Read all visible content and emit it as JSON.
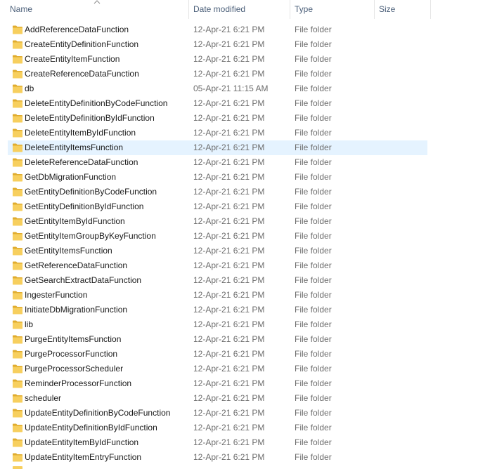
{
  "columns": {
    "name": "Name",
    "date": "Date modified",
    "type": "Type",
    "size": "Size"
  },
  "icons": {
    "sort": "sort-ascending-icon",
    "item": "folder-icon"
  },
  "colors": {
    "folder": "#f7cf5e",
    "folder_dark": "#e0ac2f",
    "selection": "#e5f3ff",
    "header_text": "#4c607a"
  },
  "selected_index": 8,
  "rows": [
    {
      "name": "AddReferenceDataFunction",
      "date": "12-Apr-21 6:21 PM",
      "type": "File folder",
      "size": ""
    },
    {
      "name": "CreateEntityDefinitionFunction",
      "date": "12-Apr-21 6:21 PM",
      "type": "File folder",
      "size": ""
    },
    {
      "name": "CreateEntityItemFunction",
      "date": "12-Apr-21 6:21 PM",
      "type": "File folder",
      "size": ""
    },
    {
      "name": "CreateReferenceDataFunction",
      "date": "12-Apr-21 6:21 PM",
      "type": "File folder",
      "size": ""
    },
    {
      "name": "db",
      "date": "05-Apr-21 11:15 AM",
      "type": "File folder",
      "size": ""
    },
    {
      "name": "DeleteEntityDefinitionByCodeFunction",
      "date": "12-Apr-21 6:21 PM",
      "type": "File folder",
      "size": ""
    },
    {
      "name": "DeleteEntityDefinitionByIdFunction",
      "date": "12-Apr-21 6:21 PM",
      "type": "File folder",
      "size": ""
    },
    {
      "name": "DeleteEntityItemByIdFunction",
      "date": "12-Apr-21 6:21 PM",
      "type": "File folder",
      "size": ""
    },
    {
      "name": "DeleteEntityItemsFunction",
      "date": "12-Apr-21 6:21 PM",
      "type": "File folder",
      "size": ""
    },
    {
      "name": "DeleteReferenceDataFunction",
      "date": "12-Apr-21 6:21 PM",
      "type": "File folder",
      "size": ""
    },
    {
      "name": "GetDbMigrationFunction",
      "date": "12-Apr-21 6:21 PM",
      "type": "File folder",
      "size": ""
    },
    {
      "name": "GetEntityDefinitionByCodeFunction",
      "date": "12-Apr-21 6:21 PM",
      "type": "File folder",
      "size": ""
    },
    {
      "name": "GetEntityDefinitionByIdFunction",
      "date": "12-Apr-21 6:21 PM",
      "type": "File folder",
      "size": ""
    },
    {
      "name": "GetEntityItemByIdFunction",
      "date": "12-Apr-21 6:21 PM",
      "type": "File folder",
      "size": ""
    },
    {
      "name": "GetEntityItemGroupByKeyFunction",
      "date": "12-Apr-21 6:21 PM",
      "type": "File folder",
      "size": ""
    },
    {
      "name": "GetEntityItemsFunction",
      "date": "12-Apr-21 6:21 PM",
      "type": "File folder",
      "size": ""
    },
    {
      "name": "GetReferenceDataFunction",
      "date": "12-Apr-21 6:21 PM",
      "type": "File folder",
      "size": ""
    },
    {
      "name": "GetSearchExtractDataFunction",
      "date": "12-Apr-21 6:21 PM",
      "type": "File folder",
      "size": ""
    },
    {
      "name": "IngesterFunction",
      "date": "12-Apr-21 6:21 PM",
      "type": "File folder",
      "size": ""
    },
    {
      "name": "InitiateDbMigrationFunction",
      "date": "12-Apr-21 6:21 PM",
      "type": "File folder",
      "size": ""
    },
    {
      "name": "lib",
      "date": "12-Apr-21 6:21 PM",
      "type": "File folder",
      "size": ""
    },
    {
      "name": "PurgeEntityItemsFunction",
      "date": "12-Apr-21 6:21 PM",
      "type": "File folder",
      "size": ""
    },
    {
      "name": "PurgeProcessorFunction",
      "date": "12-Apr-21 6:21 PM",
      "type": "File folder",
      "size": ""
    },
    {
      "name": "PurgeProcessorScheduler",
      "date": "12-Apr-21 6:21 PM",
      "type": "File folder",
      "size": ""
    },
    {
      "name": "ReminderProcessorFunction",
      "date": "12-Apr-21 6:21 PM",
      "type": "File folder",
      "size": ""
    },
    {
      "name": "scheduler",
      "date": "12-Apr-21 6:21 PM",
      "type": "File folder",
      "size": ""
    },
    {
      "name": "UpdateEntityDefinitionByCodeFunction",
      "date": "12-Apr-21 6:21 PM",
      "type": "File folder",
      "size": ""
    },
    {
      "name": "UpdateEntityDefinitionByIdFunction",
      "date": "12-Apr-21 6:21 PM",
      "type": "File folder",
      "size": ""
    },
    {
      "name": "UpdateEntityItemByIdFunction",
      "date": "12-Apr-21 6:21 PM",
      "type": "File folder",
      "size": ""
    },
    {
      "name": "UpdateEntityItemEntryFunction",
      "date": "12-Apr-21 6:21 PM",
      "type": "File folder",
      "size": ""
    }
  ]
}
